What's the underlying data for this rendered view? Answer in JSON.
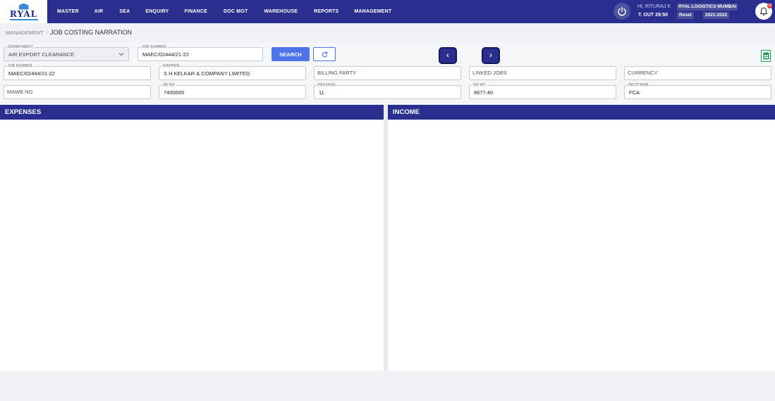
{
  "app": {
    "logo_text": "RYAL"
  },
  "nav": {
    "items": [
      "MASTER",
      "AIR",
      "SEA",
      "ENQUIRY",
      "FINANCE",
      "DOC MGT",
      "WAREHOUSE",
      "REPORTS",
      "MANAGEMENT"
    ]
  },
  "user": {
    "greeting": "HI, RITURAJ K",
    "timeout": "T. OUT 29:50",
    "company": "RYAL LOGISTICS MUMBAI",
    "reset_label": "Reset",
    "year": "2021-2022",
    "notification_count": "10"
  },
  "breadcrumb": {
    "parent": "MANAGEMENT",
    "separator": "›",
    "current": "JOB COSTING NARRATION"
  },
  "search": {
    "department_label": "DEPARTMENT",
    "department_value": "AIR EXPORT CLEARANCE",
    "job_number_label": "JOB NUMBER",
    "job_number_value": "MAEC/02444/21-22",
    "search_label": "SEARCH",
    "prev_label": "‹",
    "next_label": "›"
  },
  "details": {
    "job_number": {
      "label": "JOB NUMBER",
      "value": "MAEC/02444/21-22"
    },
    "shipper": {
      "label": "SHIPPER",
      "value": "S H KELKAR & COMPANY LIMITED"
    },
    "billing_party": {
      "placeholder": "BILLING PARTY"
    },
    "linked_jobs": {
      "placeholder": "LINKED JOBS"
    },
    "currency": {
      "placeholder": "CURRENCY"
    },
    "mawb_no": {
      "placeholder": "MAWB NO"
    },
    "sb_no": {
      "label": "SB NO",
      "value": "7400665"
    },
    "package": {
      "label": "PACKAGE",
      "value": "11"
    },
    "gr_wt": {
      "label": "GR WT",
      "value": "8677.40"
    },
    "incoterm": {
      "label": "INCOTERM",
      "value": "FCA"
    }
  },
  "panels": {
    "expenses_title": "EXPENSES",
    "income_title": "INCOME"
  },
  "colors": {
    "primary": "#2a2f8f",
    "button_blue": "#4d74e8",
    "sheet_green": "#1e9e50",
    "badge_red": "#e53935"
  }
}
